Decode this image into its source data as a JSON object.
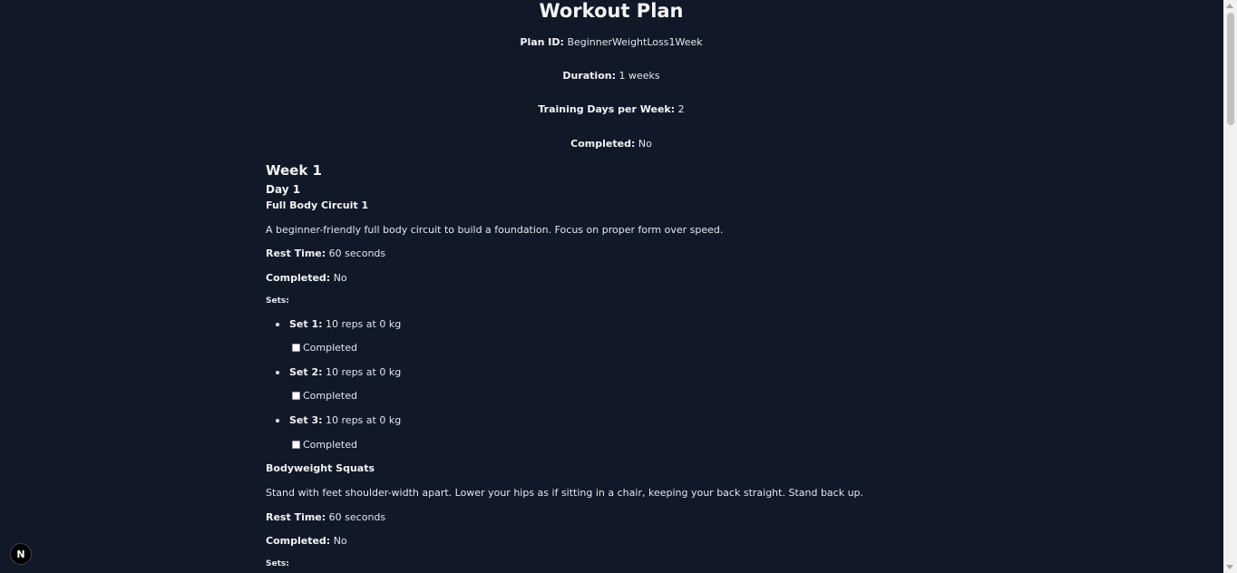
{
  "page": {
    "title": "Workout Plan"
  },
  "plan": {
    "plan_id_label": "Plan ID:",
    "plan_id": "BeginnerWeightLoss1Week",
    "duration_label": "Duration:",
    "duration": "1 weeks",
    "days_label": "Training Days per Week:",
    "days": "2",
    "completed_label": "Completed:",
    "completed": "No"
  },
  "week": {
    "title": "Week 1",
    "day_title": "Day 1"
  },
  "exercises": [
    {
      "name": "Full Body Circuit 1",
      "description": "A beginner-friendly full body circuit to build a foundation. Focus on proper form over speed.",
      "rest_label": "Rest Time:",
      "rest": "60 seconds",
      "completed_label": "Completed:",
      "completed": "No",
      "sets_label": "Sets:",
      "sets": [
        {
          "label": "Set 1:",
          "detail": "10 reps at 0 kg",
          "checkbox_label": "Completed"
        },
        {
          "label": "Set 2:",
          "detail": "10 reps at 0 kg",
          "checkbox_label": "Completed"
        },
        {
          "label": "Set 3:",
          "detail": "10 reps at 0 kg",
          "checkbox_label": "Completed"
        }
      ]
    },
    {
      "name": "Bodyweight Squats",
      "description": "Stand with feet shoulder-width apart. Lower your hips as if sitting in a chair, keeping your back straight. Stand back up.",
      "rest_label": "Rest Time:",
      "rest": "60 seconds",
      "completed_label": "Completed:",
      "completed": "No",
      "sets_label": "Sets:"
    }
  ],
  "badge": {
    "letter": "N"
  },
  "colors": {
    "background": "#111827",
    "text": "#e5e7eb"
  }
}
